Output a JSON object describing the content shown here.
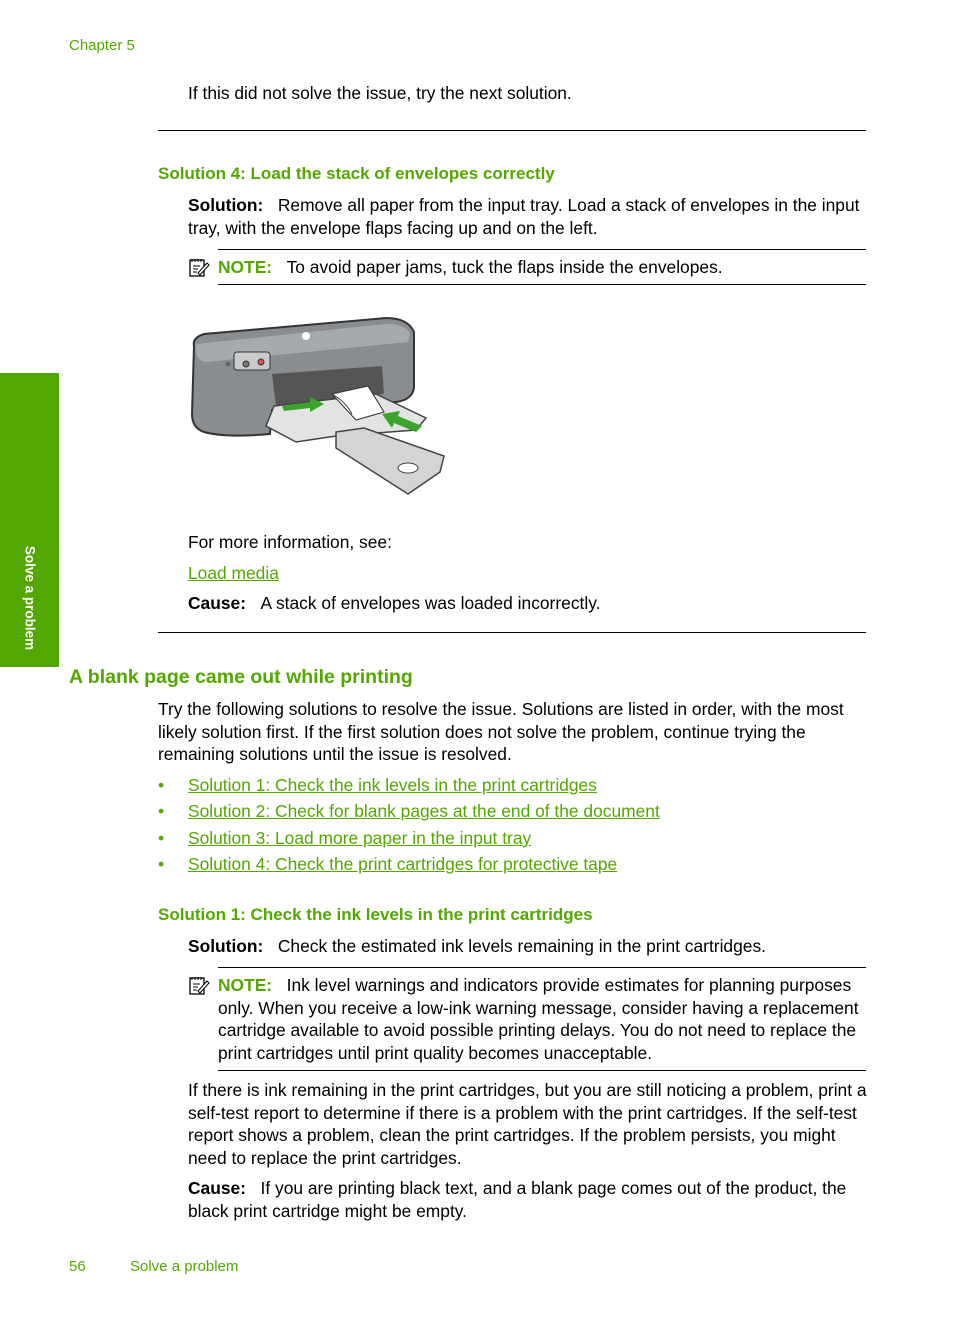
{
  "header": {
    "chapter": "Chapter 5"
  },
  "side_tab": {
    "label": "Solve a problem"
  },
  "intro": "If this did not solve the issue, try the next solution.",
  "solution4_envelopes": {
    "title": "Solution 4: Load the stack of envelopes correctly",
    "solution_label": "Solution:",
    "solution_text": "Remove all paper from the input tray. Load a stack of envelopes in the input tray, with the envelope flaps facing up and on the left.",
    "note_label": "NOTE:",
    "note_text": "To avoid paper jams, tuck the flaps inside the envelopes.",
    "figure_alt": "Printer with envelopes being loaded into the input tray",
    "more_info": "For more information, see:",
    "link": "Load media",
    "cause_label": "Cause:",
    "cause_text": "A stack of envelopes was loaded incorrectly."
  },
  "blank_page": {
    "title": "A blank page came out while printing",
    "intro": "Try the following solutions to resolve the issue. Solutions are listed in order, with the most likely solution first. If the first solution does not solve the problem, continue trying the remaining solutions until the issue is resolved.",
    "bullet": "•",
    "links": [
      "Solution 1: Check the ink levels in the print cartridges",
      "Solution 2: Check for blank pages at the end of the document",
      "Solution 3: Load more paper in the input tray",
      "Solution 4: Check the print cartridges for protective tape"
    ]
  },
  "solution1_ink": {
    "title": "Solution 1: Check the ink levels in the print cartridges",
    "solution_label": "Solution:",
    "solution_text": "Check the estimated ink levels remaining in the print cartridges.",
    "note_label": "NOTE:",
    "note_text": "Ink level warnings and indicators provide estimates for planning purposes only. When you receive a low-ink warning message, consider having a replacement cartridge available to avoid possible printing delays. You do not need to replace the print cartridges until print quality becomes unacceptable.",
    "para": "If there is ink remaining in the print cartridges, but you are still noticing a problem, print a self-test report to determine if there is a problem with the print cartridges. If the self-test report shows a problem, clean the print cartridges. If the problem persists, you might need to replace the print cartridges.",
    "cause_label": "Cause:",
    "cause_text": "If you are printing black text, and a blank page comes out of the product, the black print cartridge might be empty."
  },
  "footer": {
    "page_number": "56",
    "section": "Solve a problem"
  },
  "colors": {
    "accent": "#52a800",
    "text": "#000000"
  }
}
